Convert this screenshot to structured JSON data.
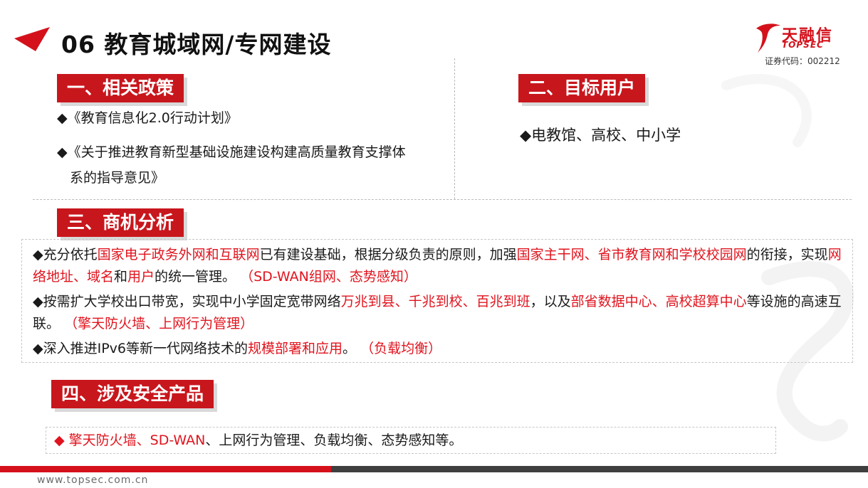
{
  "header": {
    "title": "06 教育城域网/专网建设",
    "logo": {
      "brand": "天融信",
      "latin": "TOPSEC",
      "stock_code": "证券代码：002212"
    }
  },
  "section1": {
    "heading": "一、相关政策",
    "items": [
      "◆《教育信息化2.0行动计划》",
      "◆《关于推进教育新型基础设施建设构建高质量教育支撑体",
      "系的指导意见》"
    ]
  },
  "section2": {
    "heading": "二、目标用户",
    "item": "◆电教馆、高校、中小学"
  },
  "section3": {
    "heading": "三、商机分析",
    "p1": {
      "a": "◆充分依托",
      "b": "国家电子政务外网和互联网",
      "c": "已有建设基础，根据分级负责的原则，加强",
      "d": "国家主干网、省市教育网和学校校园网",
      "e": "的衔接，实现",
      "f": "网络地址、域名",
      "g": "和",
      "h": "用户",
      "i": "的统一管理。",
      "j": "（SD-WAN组网、态势感知）"
    },
    "p2": {
      "a": "◆按需扩大学校出口带宽，实现中小学固定宽带网络",
      "b": "万兆到县、千兆到校、百兆到班",
      "c": "，以及",
      "d": "部省数据中心、高校超算中心",
      "e": "等设施的高速互联。",
      "f": "（擎天防火墙、上网行为管理）"
    },
    "p3": {
      "a": "◆深入推进IPv6等新一代网络技术的",
      "b": "规模部署和应用",
      "c": "。",
      "d": "（负载均衡）"
    }
  },
  "section4": {
    "heading": "四、涉及安全产品",
    "red": "◆ 擎天防火墙、SD-WAN",
    "rest": "、上网行为管理、负载均衡、态势感知等。"
  },
  "footer": {
    "url": "www.topsec.com.cn"
  },
  "colors": {
    "brand_red": "#d4111b",
    "highlight_red": "#e0141e",
    "footer_dark": "#3f3f3f"
  }
}
